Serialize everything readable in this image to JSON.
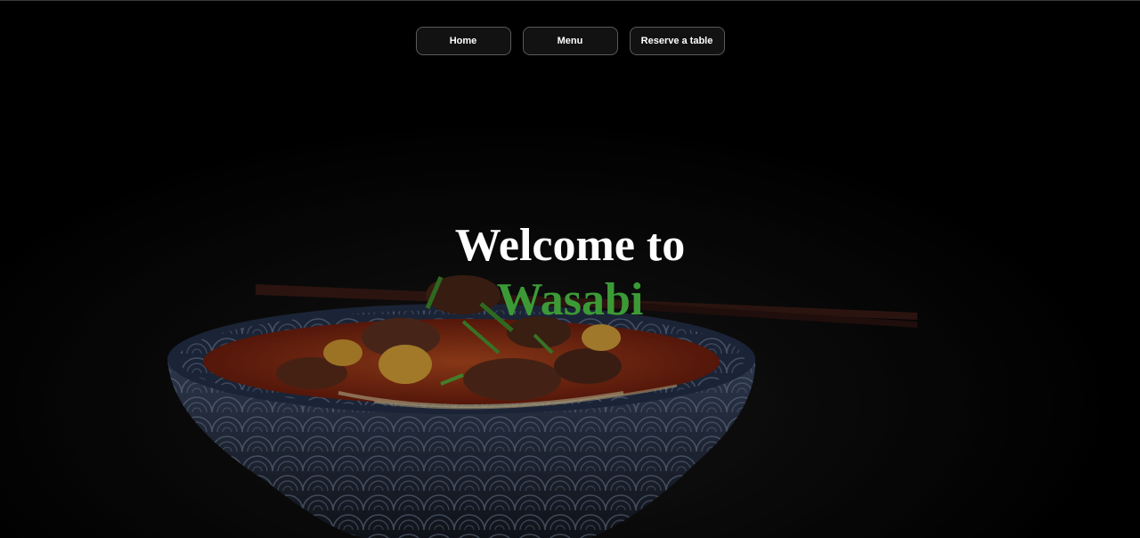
{
  "nav": {
    "items": [
      {
        "label": "Home"
      },
      {
        "label": "Menu"
      },
      {
        "label": "Reserve a table"
      }
    ]
  },
  "hero": {
    "line1": "Welcome to",
    "brand": "Wasabi",
    "brand_color": "#3c9a36",
    "background_color": "#000000",
    "image": "noodle-bowl-with-chopsticks"
  }
}
